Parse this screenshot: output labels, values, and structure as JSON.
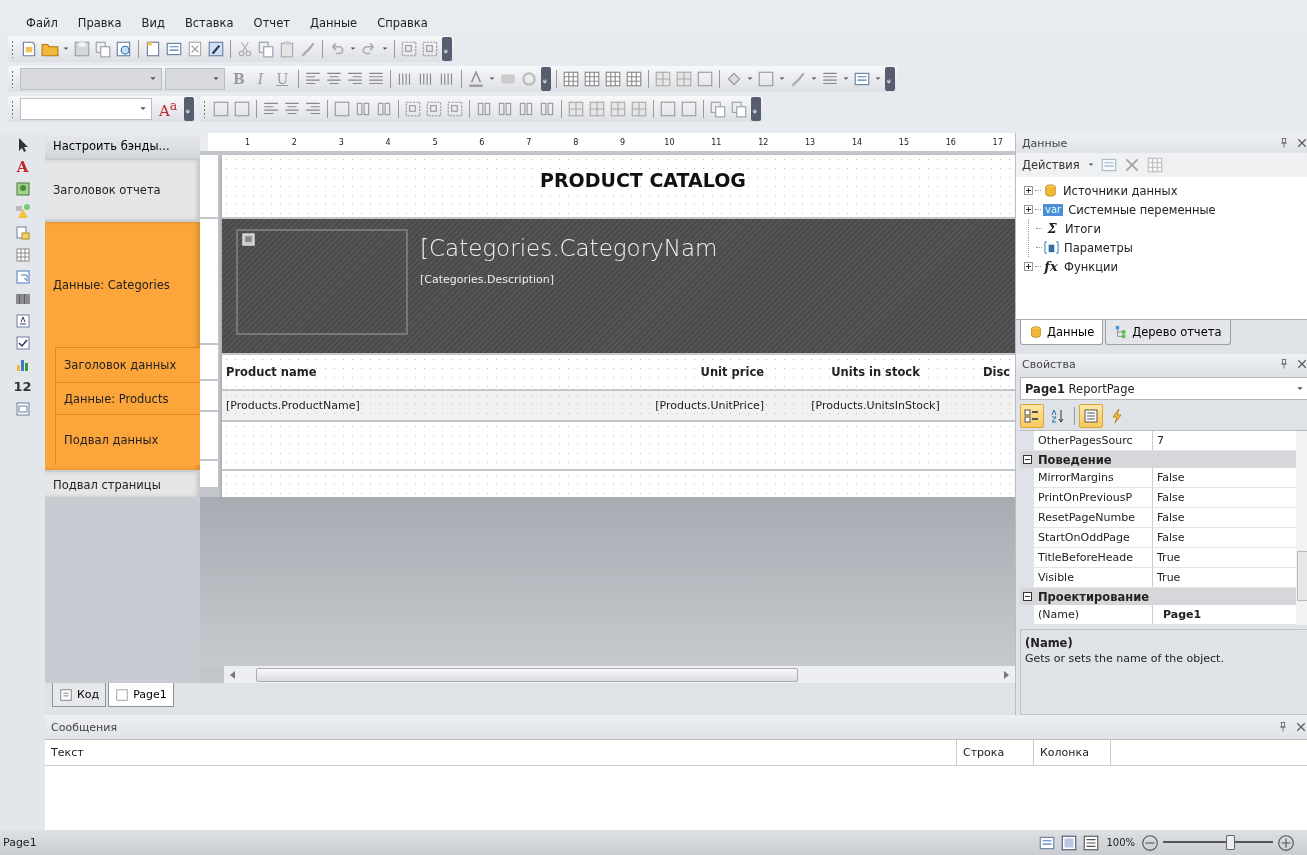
{
  "menu": [
    "Файл",
    "Правка",
    "Вид",
    "Вставка",
    "Отчет",
    "Данные",
    "Справка"
  ],
  "format_toolbar": {
    "styles": [
      "B",
      "I",
      "U"
    ],
    "style_button": "A$^{a}$"
  },
  "tools": [
    {
      "kind": "pointer"
    },
    {
      "kind": "glyph",
      "glyph": "A"
    },
    {
      "kind": "picture"
    },
    {
      "kind": "shapes"
    },
    {
      "kind": "subreport"
    },
    {
      "kind": "table"
    },
    {
      "kind": "matrix"
    },
    {
      "kind": "barcode"
    },
    {
      "kind": "textbox"
    },
    {
      "kind": "checkbox"
    },
    {
      "kind": "chart"
    },
    {
      "kind": "glyph",
      "glyph": "12"
    },
    {
      "kind": "zipcode"
    }
  ],
  "bands_panel": {
    "configure_button": "Настроить бэнды...",
    "bands": [
      {
        "label": "Заголовок отчета",
        "color": "#e6e6e6"
      },
      {
        "label": "Данные: Categories",
        "color": "#fca53a",
        "children": [
          {
            "label": "Заголовок данных",
            "color": "#fca53a"
          },
          {
            "label": "Данные: Products",
            "color": "#fca53a"
          },
          {
            "label": "Подвал данных",
            "color": "#fca53a"
          }
        ]
      },
      {
        "label": "Подвал страницы",
        "color": "#e6e6e6"
      }
    ]
  },
  "report": {
    "ruler": [
      "1",
      "2",
      "3",
      "4",
      "5",
      "6",
      "7",
      "8",
      "9",
      "10",
      "11",
      "12",
      "13",
      "14",
      "15",
      "16",
      "17"
    ],
    "title": "PRODUCT CATALOG",
    "category_name": "[Categories.CategoryNam",
    "category_description": "[Categories.Description]",
    "columns": [
      {
        "header": "Product name",
        "field": "[Products.ProductName]"
      },
      {
        "header": "Unit price",
        "field": "[Products.UnitPrice]"
      },
      {
        "header": "Units in stock",
        "field": "[Products.UnitsInStock]"
      },
      {
        "header": "Disc"
      }
    ]
  },
  "page_tabs": [
    {
      "label": "Код",
      "kind": "code",
      "selected": false
    },
    {
      "label": "Page1",
      "kind": "page",
      "selected": true
    }
  ],
  "data_panel": {
    "title": "Данные",
    "actions": "Действия",
    "tree": [
      {
        "label": "Источники данных",
        "kind": "database",
        "collapsed": true
      },
      {
        "label": "Системные переменные",
        "kind": "badge",
        "badge": "var",
        "collapsed": true
      },
      {
        "label": "Итоги",
        "kind": "glyph",
        "glyph": "Σ",
        "collapsed": false
      },
      {
        "label": "Параметры",
        "kind": "params",
        "collapsed": false
      },
      {
        "label": "Функции",
        "kind": "glyph",
        "glyph": "fx",
        "collapsed": true
      }
    ],
    "tabs": [
      {
        "label": "Данные",
        "kind": "database",
        "selected": true
      },
      {
        "label": "Дерево отчета",
        "kind": "tree",
        "selected": false
      }
    ]
  },
  "properties": {
    "title": "Свойства",
    "object_name": "Page1",
    "object_type": "ReportPage",
    "toolbar": [
      {
        "kind": "categorized",
        "selected": true
      },
      {
        "kind": "alphabetical",
        "selected": false
      },
      {
        "kind": "properties",
        "selected": true
      },
      {
        "kind": "events",
        "selected": false
      }
    ],
    "rows": [
      {
        "kind": "property",
        "name": "OtherPagesSourc",
        "value": "7",
        "modified": false
      },
      {
        "kind": "category",
        "name": "Поведение"
      },
      {
        "kind": "property",
        "name": "MirrorMargins",
        "value": "False",
        "modified": false
      },
      {
        "kind": "property",
        "name": "PrintOnPreviousP",
        "value": "False",
        "modified": false
      },
      {
        "kind": "property",
        "name": "ResetPageNumbe",
        "value": "False",
        "modified": false
      },
      {
        "kind": "property",
        "name": "StartOnOddPage",
        "value": "False",
        "modified": false
      },
      {
        "kind": "property",
        "name": "TitleBeforeHeade",
        "value": "True",
        "modified": false
      },
      {
        "kind": "property",
        "name": "Visible",
        "value": "True",
        "modified": false
      },
      {
        "kind": "category",
        "name": "Проектирование"
      },
      {
        "kind": "property",
        "name": "(Name)",
        "value": "Page1",
        "modified": true
      }
    ],
    "description": {
      "title": "(Name)",
      "text": "Gets or sets the name of the object."
    }
  },
  "messages": {
    "title": "Сообщения",
    "columns": [
      "Текст",
      "Строка",
      "Колонка"
    ]
  },
  "status_bar": {
    "page": "Page1",
    "zoom": "100%",
    "level": 0.6
  }
}
